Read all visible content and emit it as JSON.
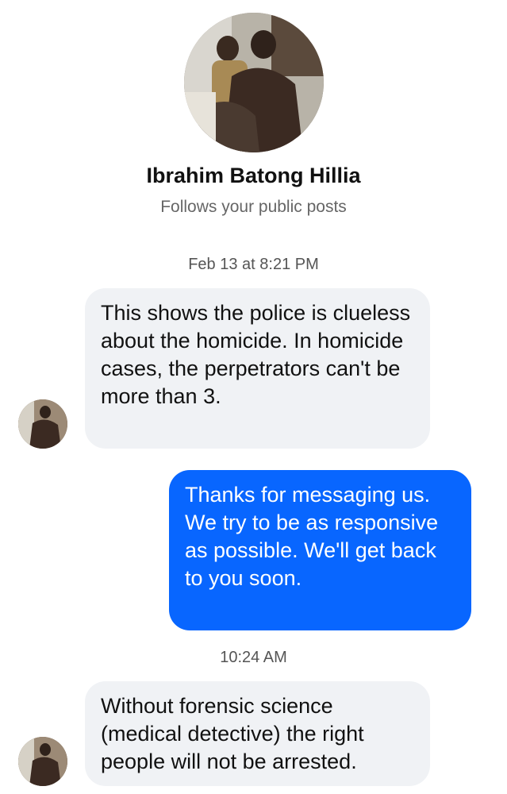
{
  "header": {
    "name": "Ibrahim Batong Hillia",
    "subtitle": "Follows your public posts"
  },
  "timestamps": [
    "Feb 13 at 8:21 PM",
    "10:24 AM"
  ],
  "messages": [
    {
      "sender": "incoming",
      "text": "This shows the police is clueless about the homicide. In homicide cases, the perpetrators can't be more than 3."
    },
    {
      "sender": "outgoing",
      "text": "Thanks for messaging us. We try to be as responsive as possible. We'll get back to you soon."
    },
    {
      "sender": "incoming",
      "text": "Without forensic science (medical detective) the right people will not be arrested."
    }
  ],
  "colors": {
    "outgoing_bubble": "#0866ff",
    "incoming_bubble": "#f0f2f5"
  }
}
